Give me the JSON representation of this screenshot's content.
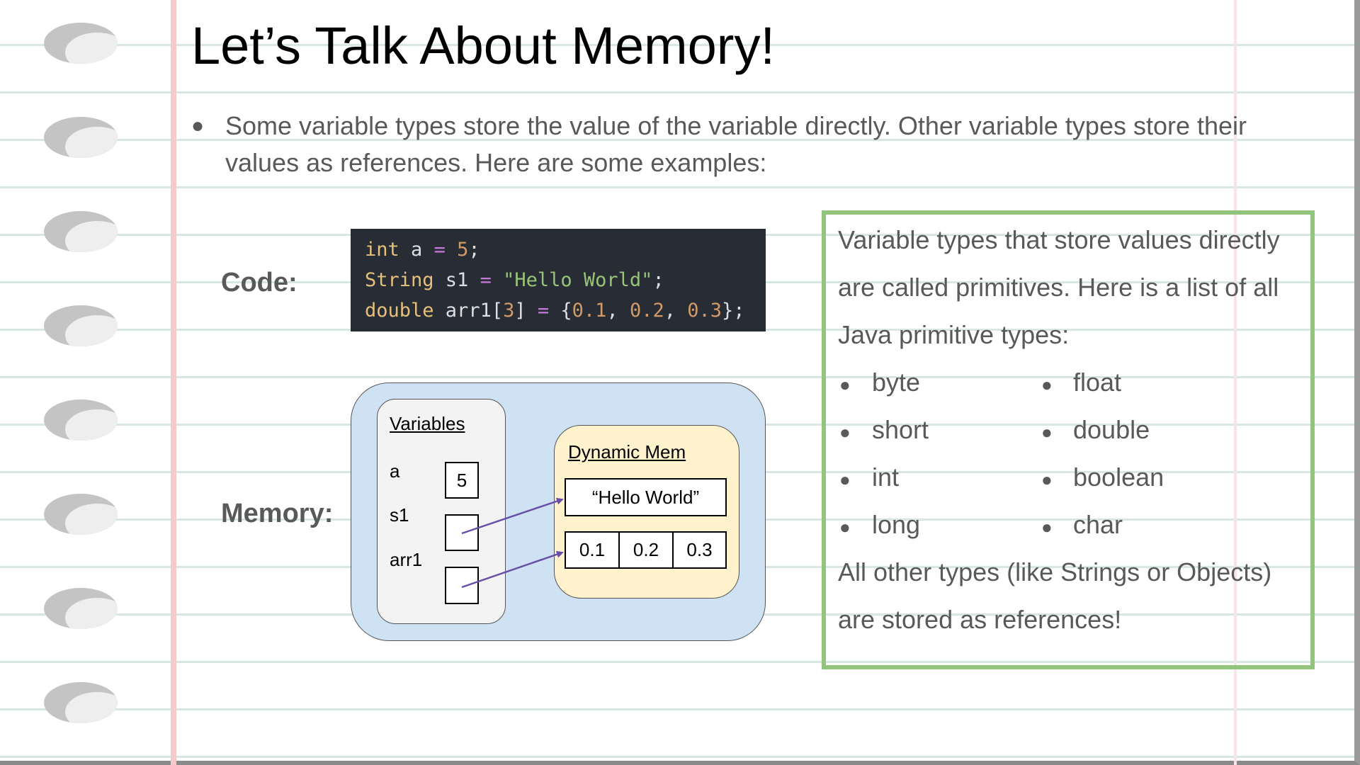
{
  "slide": {
    "title": "Let’s Talk About Memory!",
    "bullet": "Some variable types store the value of the variable directly. Other variable types store their values as references. Here are some examples:",
    "code_label": "Code:",
    "memory_label": "Memory:"
  },
  "code": {
    "line1": {
      "kw": "int",
      "name": " a ",
      "op": "=",
      "sp": " ",
      "num": "5",
      "end": ";"
    },
    "line2": {
      "kw": "String",
      "name": " s1 ",
      "op": "=",
      "sp": " ",
      "str": "\"Hello World\"",
      "end": ";"
    },
    "line3": {
      "kw": "double",
      "name": " arr1[",
      "size": "3",
      "close": "] ",
      "op": "=",
      "open": " {",
      "v1": "0.1",
      "comma1": ", ",
      "v2": "0.2",
      "comma2": ", ",
      "v3": "0.3",
      "end": "};"
    }
  },
  "memory": {
    "variables_title": "Variables",
    "var_a": "a",
    "var_s1": "s1",
    "var_arr1": "arr1",
    "a_value": "5",
    "dynamic_title": "Dynamic Mem",
    "string_value": "“Hello World”",
    "array_values": [
      "0.1",
      "0.2",
      "0.3"
    ]
  },
  "primitives": {
    "intro_line1": "Variable types that store values directly",
    "intro_line2": "are called primitives. Here is a list of all",
    "intro_line3": "Java primitive types:",
    "types": [
      "byte",
      "float",
      "short",
      "double",
      "int",
      "boolean",
      "long",
      "char"
    ],
    "outro_line1": "All other types (like Strings or Objects)",
    "outro_line2": "are stored as references!"
  },
  "colors": {
    "primitive_border": "#93c47d",
    "memory_bg": "#cfe2f3",
    "dynamic_bg": "#fff2cc",
    "arrow": "#674ea7",
    "code_bg": "#282c34"
  }
}
